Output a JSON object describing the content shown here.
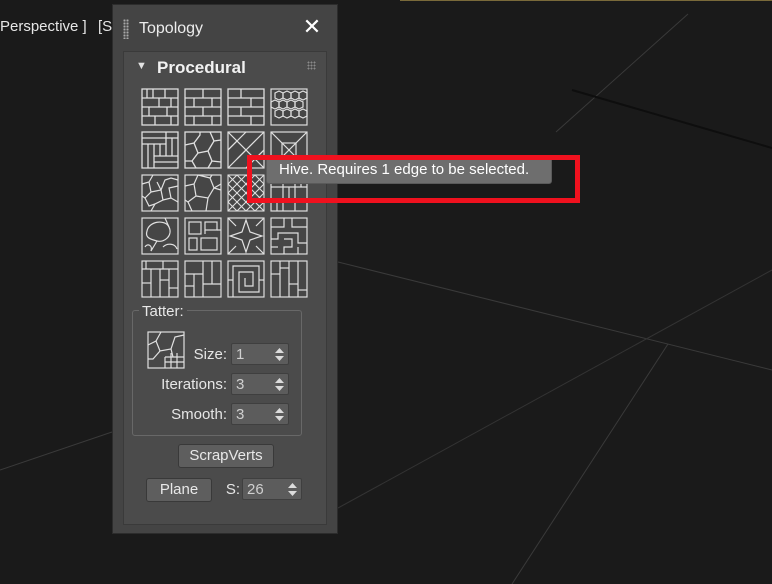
{
  "viewport": {
    "label": "Perspective ]",
    "label_2": "[S"
  },
  "panel": {
    "title": "Topology",
    "close_icon": "close-icon"
  },
  "rollout": {
    "title": "Procedural"
  },
  "tooltip": {
    "text": "Hive. Requires 1 edge to be selected."
  },
  "tatter": {
    "label": "Tatter:",
    "size_label": "Size:",
    "size_value": "1",
    "iterations_label": "Iterations:",
    "iterations_value": "3",
    "smooth_label": "Smooth:",
    "smooth_value": "3"
  },
  "buttons": {
    "scrapverts": "ScrapVerts",
    "plane": "Plane"
  },
  "plane": {
    "s_label": "S:",
    "s_value": "26"
  },
  "colors": {
    "highlight": "#f0111e",
    "panel_bg": "#444444",
    "viewport_bg": "#1a1a1a"
  }
}
